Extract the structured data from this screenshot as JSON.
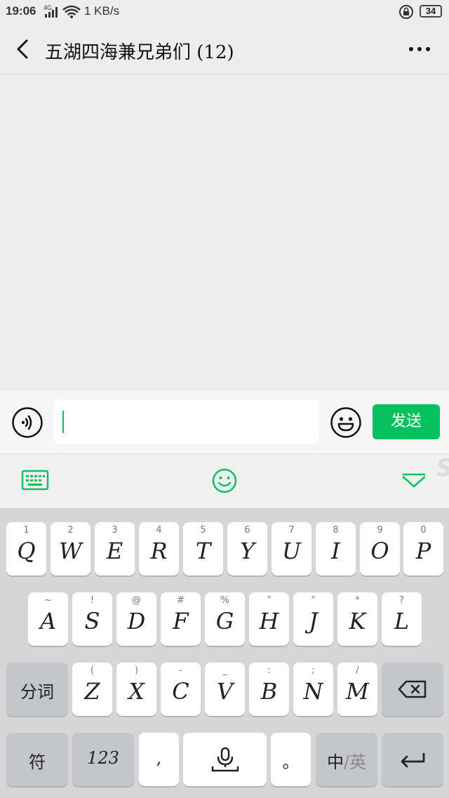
{
  "status_bar": {
    "time": "19:06",
    "network": "4G",
    "speed": "1 KB/s",
    "battery": "34"
  },
  "header": {
    "title": "五湖四海兼兄弟们 (12)"
  },
  "input_bar": {
    "text_value": "",
    "send_label": "发送"
  },
  "keyboard": {
    "row1": [
      {
        "main": "Q",
        "sub": "1"
      },
      {
        "main": "W",
        "sub": "2"
      },
      {
        "main": "E",
        "sub": "3"
      },
      {
        "main": "R",
        "sub": "4"
      },
      {
        "main": "T",
        "sub": "5"
      },
      {
        "main": "Y",
        "sub": "6"
      },
      {
        "main": "U",
        "sub": "7"
      },
      {
        "main": "I",
        "sub": "8"
      },
      {
        "main": "O",
        "sub": "9"
      },
      {
        "main": "P",
        "sub": "0"
      }
    ],
    "row2": [
      {
        "main": "A",
        "sub": "~"
      },
      {
        "main": "S",
        "sub": "!"
      },
      {
        "main": "D",
        "sub": "@"
      },
      {
        "main": "F",
        "sub": "#"
      },
      {
        "main": "G",
        "sub": "%"
      },
      {
        "main": "H",
        "sub": "\""
      },
      {
        "main": "J",
        "sub": "\""
      },
      {
        "main": "K",
        "sub": "*"
      },
      {
        "main": "L",
        "sub": "?"
      }
    ],
    "row3": [
      {
        "main": "Z",
        "sub": "("
      },
      {
        "main": "X",
        "sub": ")"
      },
      {
        "main": "C",
        "sub": "-"
      },
      {
        "main": "V",
        "sub": "_"
      },
      {
        "main": "B",
        "sub": ":"
      },
      {
        "main": "N",
        "sub": ";"
      },
      {
        "main": "M",
        "sub": "/"
      }
    ],
    "fenci_label": "分词",
    "symbol_label": "符",
    "numbers_label": "123",
    "comma_label": ",",
    "period_label": "。",
    "lang_zh": "中",
    "lang_sep": "/",
    "lang_en": "英"
  },
  "colors": {
    "accent": "#07c160",
    "background": "#ededed",
    "keyboard_bg": "#d6d6d6"
  }
}
